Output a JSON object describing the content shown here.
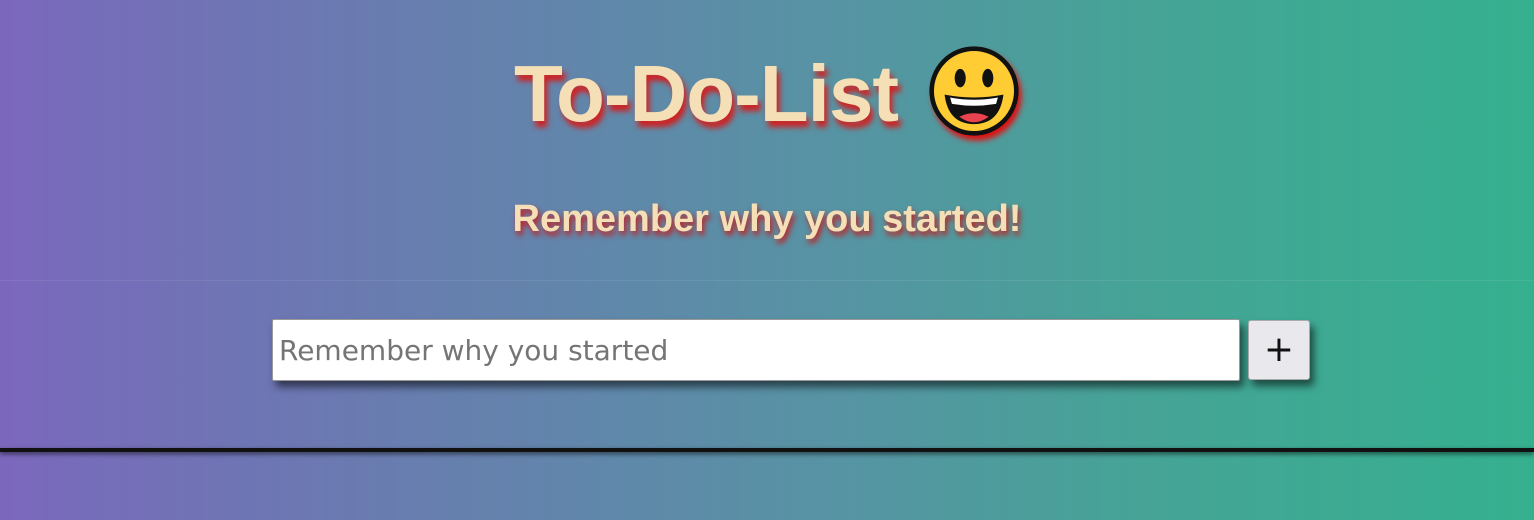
{
  "header": {
    "title": "To-Do-List",
    "emoji_icon": "grinning-face-icon",
    "subtitle": "Remember why you started!"
  },
  "form": {
    "input_placeholder": "Remember why you started",
    "input_value": "",
    "add_button_label": "+"
  },
  "colors": {
    "gradient_start": "#7b68bd",
    "gradient_end": "#35b08f",
    "title_text": "#f5dfb6",
    "title_shadow": "#d12020"
  }
}
